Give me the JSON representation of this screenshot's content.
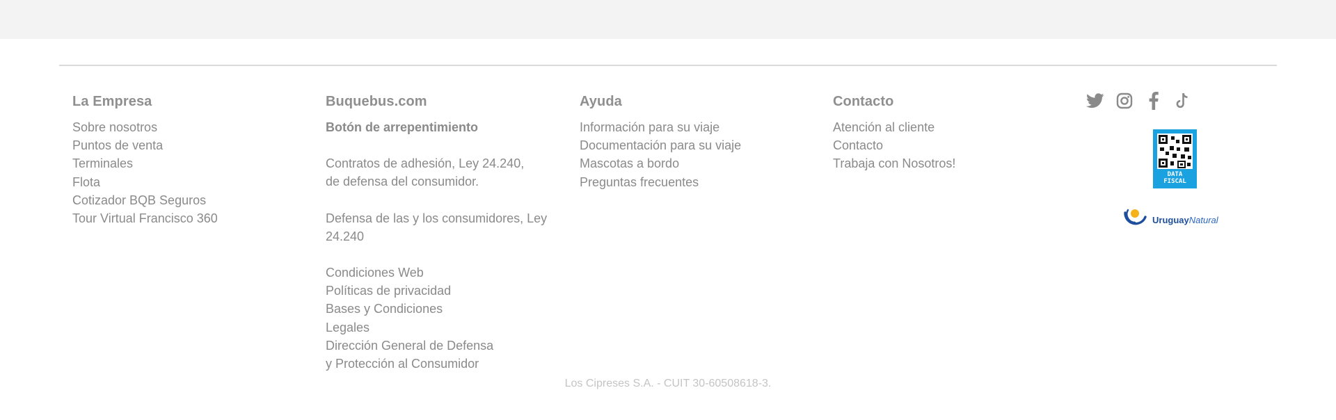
{
  "footer": {
    "columns": [
      {
        "title": "La Empresa",
        "items": [
          {
            "label": "Sobre nosotros"
          },
          {
            "label": "Puntos de venta"
          },
          {
            "label": "Terminales"
          },
          {
            "label": "Flota"
          },
          {
            "label": "Cotizador BQB Seguros"
          },
          {
            "label": "Tour Virtual Francisco 360"
          }
        ]
      },
      {
        "title": "Buquebus.com",
        "items": [
          {
            "label": "Botón de arrepentimiento"
          },
          {
            "label": "Contratos de adhesión, Ley 24.240,"
          },
          {
            "label": "de defensa del consumidor."
          },
          {
            "label": "Defensa de las y los consumidores, Ley"
          },
          {
            "label": "24.240"
          },
          {
            "label": "Condiciones Web"
          },
          {
            "label": "Políticas de privacidad"
          },
          {
            "label": "Bases y Condiciones"
          },
          {
            "label": "Legales"
          },
          {
            "label": "Dirección General de Defensa"
          },
          {
            "label": "y Protección al Consumidor"
          }
        ]
      },
      {
        "title": "Ayuda",
        "items": [
          {
            "label": "Información para su viaje"
          },
          {
            "label": "Documentación para su viaje"
          },
          {
            "label": "Mascotas a bordo"
          },
          {
            "label": "Preguntas frecuentes"
          }
        ]
      },
      {
        "title": "Contacto",
        "items": [
          {
            "label": "Atención al cliente"
          },
          {
            "label": "Contacto"
          },
          {
            "label": "Trabaja con Nosotros!"
          }
        ]
      }
    ],
    "social": [
      {
        "name": "twitter-icon"
      },
      {
        "name": "instagram-icon"
      },
      {
        "name": "facebook-icon"
      },
      {
        "name": "tiktok-icon"
      }
    ],
    "data_fiscal": {
      "text_line1": "DATA",
      "text_line2": "FISCAL"
    },
    "uruguay_natural": {
      "bold": "Uruguay",
      "italic": "Natural"
    },
    "copyright": "Los Cipreses S.A. - CUIT 30-60508618-3.",
    "colors": {
      "text": "#8a8a8a",
      "top_band": "#f3f3f3",
      "data_fiscal": "#1aa1e0",
      "uruguay_blue": "#1e4f9c",
      "sun_yellow": "#f5b21a"
    }
  }
}
